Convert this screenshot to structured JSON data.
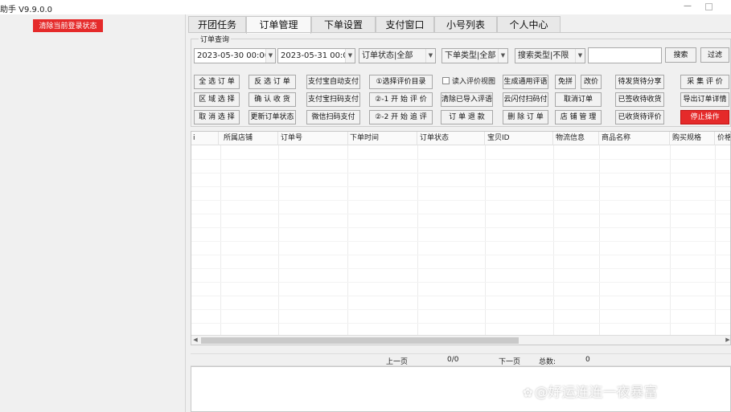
{
  "window": {
    "title": "助手  V9.9.0.0"
  },
  "left_panel": {
    "clear_login_label": "清除当前登录状态"
  },
  "tabs": [
    {
      "label": "开团任务",
      "active": false
    },
    {
      "label": "订单管理",
      "active": true
    },
    {
      "label": "下单设置",
      "active": false
    },
    {
      "label": "支付窗口",
      "active": false
    },
    {
      "label": "小号列表",
      "active": false
    },
    {
      "label": "个人中心",
      "active": false
    }
  ],
  "order_query": {
    "legend": "订单查询",
    "start_date": "2023-05-30 00:00:",
    "end_date": "2023-05-31 00:0(",
    "order_status": "订单状态|全部",
    "order_type": "下单类型|全部",
    "search_type": "搜索类型|不限",
    "search_value": "",
    "search_label": "搜索",
    "filter_label": "过滤"
  },
  "buttons": {
    "select_all": "全 选 订 单",
    "invert_select": "反 选 订 单",
    "alipay_auto_pay": "支付宝自动支付",
    "select_review_dir": "①选择评价目录",
    "import_review_image": "读入评价视图",
    "gen_common_review": "生成通用评语",
    "free_pin": "免拼",
    "change_price": "改价",
    "pending_share": "待发货待分享",
    "collect_review": "采 集 评 价",
    "range_select": "区 域 选 择",
    "confirm_receipt": "确 认 收 货",
    "alipay_scan_pay": "支付宝扫码支付",
    "start_review_1": "②-1  开 始 评 价",
    "clear_imported_reviews": "清除已导入评语",
    "yunshan_scan_pay": "云闪付扫码付",
    "cancel_order": "取消订单",
    "signed_pending_receipt": "已签收待收货",
    "export_order_detail": "导出订单详情",
    "cancel_select": "取 消 选 择",
    "update_order_status": "更新订单状态",
    "wechat_scan_pay": "微信扫码支付",
    "start_review_2": "②-2  开 始 追 评",
    "order_refund": "订 单 退 款",
    "delete_order": "删 除 订 单",
    "store_manage": "店 铺 管 理",
    "received_pending_review": "已收货待评价",
    "stop_operation": "停止操作"
  },
  "grid": {
    "columns": [
      "i",
      "所属店铺",
      "订单号",
      "下单时间",
      "订单状态",
      "宝贝ID",
      "物流信息",
      "商品名称",
      "购买规格",
      "价格"
    ],
    "rows": []
  },
  "pager": {
    "prev_label": "上一页",
    "page_info": "0/0",
    "next_label": "下一页",
    "total_label": "总数:",
    "total_value": "0"
  },
  "watermark": {
    "text": "@好运连连一夜暴富"
  },
  "colors": {
    "accent_red": "#e52a2a",
    "background": "#f0f0f0",
    "grid_bg": "#ffffff"
  }
}
